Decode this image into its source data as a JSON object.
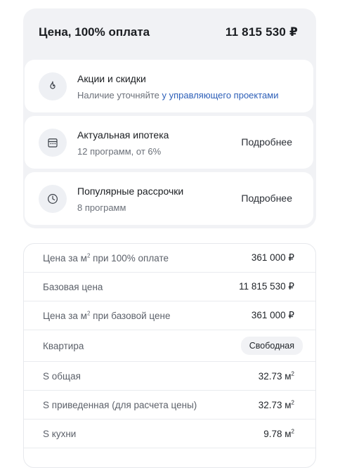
{
  "price_card": {
    "title": "Цена, 100% оплата",
    "amount": "11 815 530 ₽",
    "offers": [
      {
        "icon": "flame-icon",
        "title": "Акции и скидки",
        "subtitle_prefix": "Наличие уточняйте ",
        "subtitle_link": "у управляющего проектами"
      },
      {
        "icon": "calendar-icon",
        "title": "Актуальная ипотека",
        "subtitle": "12 программ, от 6%",
        "action": "Подробнее"
      },
      {
        "icon": "clock-icon",
        "title": "Популярные рассрочки",
        "subtitle": "8 программ",
        "action": "Подробнее"
      }
    ]
  },
  "params": {
    "rows": [
      {
        "label": "Цена за м",
        "label_sup": "2",
        "label_rest": " при 100% оплате",
        "value": "361 000 ₽"
      },
      {
        "label": "Базовая цена",
        "value": "11 815 530 ₽"
      },
      {
        "label": "Цена за м",
        "label_sup": "2",
        "label_rest": " при базовой цене",
        "value": "361 000 ₽"
      },
      {
        "label": "Квартира",
        "badge": "Свободная"
      },
      {
        "label": "S общая",
        "value": "32.73 м",
        "value_sup": "2"
      },
      {
        "label": "S приведенная (для расчета цены)",
        "value": "32.73 м",
        "value_sup": "2"
      },
      {
        "label": "S кухни",
        "value": "9.78 м",
        "value_sup": "2"
      }
    ]
  }
}
